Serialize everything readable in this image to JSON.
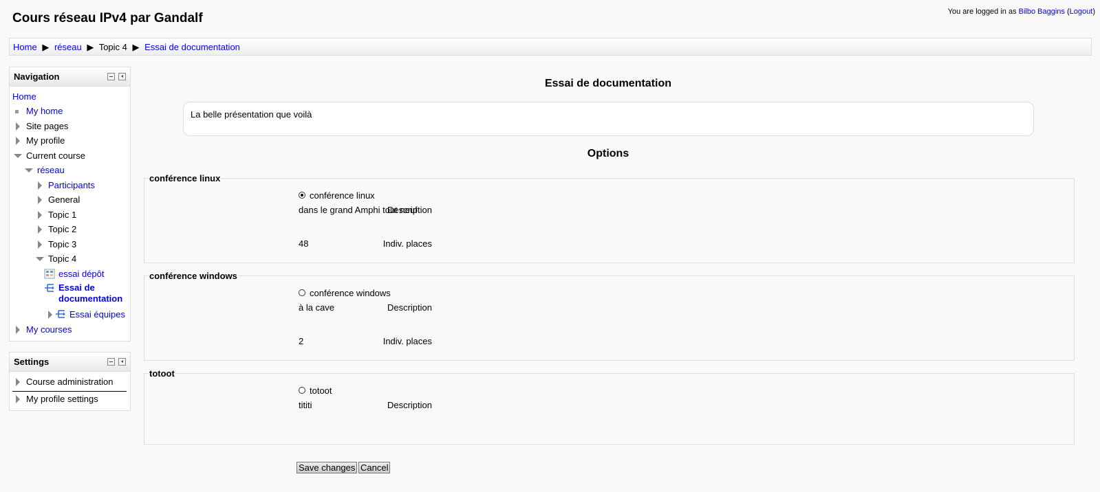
{
  "header": {
    "title": "Cours réseau IPv4 par Gandalf",
    "login_prefix": "You are logged in as",
    "user": "Bilbo Baggins",
    "logout": "Logout"
  },
  "breadcrumb": {
    "items": [
      "Home",
      "réseau",
      "Topic 4",
      "Essai de documentation"
    ],
    "separator": "▶"
  },
  "navigation": {
    "title": "Navigation",
    "home": "Home",
    "my_home": "My home",
    "site_pages": "Site pages",
    "my_profile": "My profile",
    "current_course": "Current course",
    "course": "réseau",
    "participants": "Participants",
    "general": "General",
    "topic1": "Topic 1",
    "topic2": "Topic 2",
    "topic3": "Topic 3",
    "topic4": "Topic 4",
    "essai_depot": "essai dépôt",
    "essai_doc_line1": "Essai de",
    "essai_doc_line2": "documentation",
    "essai_equipes": "Essai équipes",
    "my_courses": "My courses"
  },
  "settings": {
    "title": "Settings",
    "course_admin": "Course administration",
    "profile_settings": "My profile settings"
  },
  "main": {
    "title": "Essai de documentation",
    "intro": "La belle présentation que voilà",
    "options_title": "Options",
    "description_label": "Description",
    "places_label": "Indiv. places",
    "options": [
      {
        "legend": "conférence linux",
        "radio_label": "conférence linux",
        "checked": true,
        "description": "dans le grand Amphi tout neuf",
        "places": "48"
      },
      {
        "legend": "conférence windows",
        "radio_label": "conférence windows",
        "checked": false,
        "description": "à la cave",
        "places": "2"
      },
      {
        "legend": "totoot",
        "radio_label": "totoot",
        "checked": false,
        "description": "tititi"
      }
    ],
    "save_label": "Save changes",
    "cancel_label": "Cancel"
  }
}
